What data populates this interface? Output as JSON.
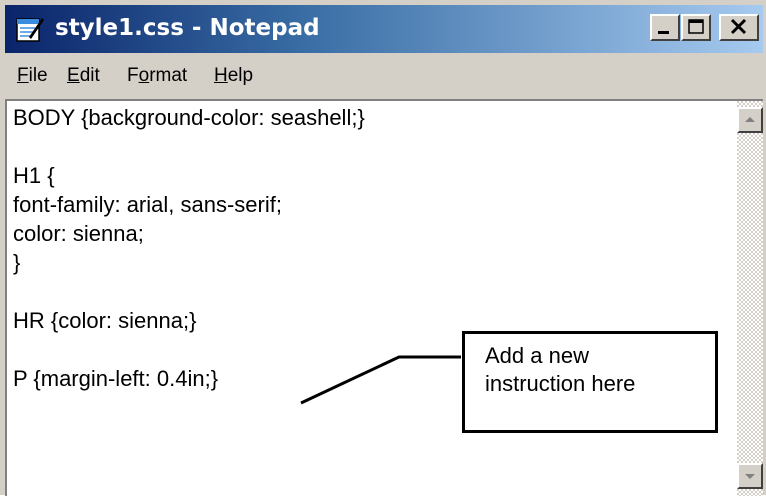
{
  "window": {
    "title": "style1.css - Notepad",
    "controls": {
      "minimize_icon": "minimize-icon",
      "maximize_icon": "maximize-icon",
      "close_icon": "close-icon"
    }
  },
  "menu": {
    "items": [
      {
        "accel": "F",
        "rest": "ile"
      },
      {
        "accel": "E",
        "rest": "dit"
      },
      {
        "pre": "F",
        "accel": "o",
        "rest": "rmat"
      },
      {
        "accel": "H",
        "rest": "elp"
      }
    ]
  },
  "editor": {
    "lines": [
      "BODY {background-color: seashell;}",
      "",
      "H1 {",
      "font-family: arial, sans-serif;",
      "color: sienna;",
      "}",
      "",
      "HR {color: sienna;}",
      "",
      "P {margin-left: 0.4in;}"
    ]
  },
  "callout": {
    "text": "Add a new\ninstruction here"
  },
  "colors": {
    "titlebar_start": "#0a246a",
    "titlebar_end": "#a6caf0",
    "chrome": "#d4d0c8"
  }
}
